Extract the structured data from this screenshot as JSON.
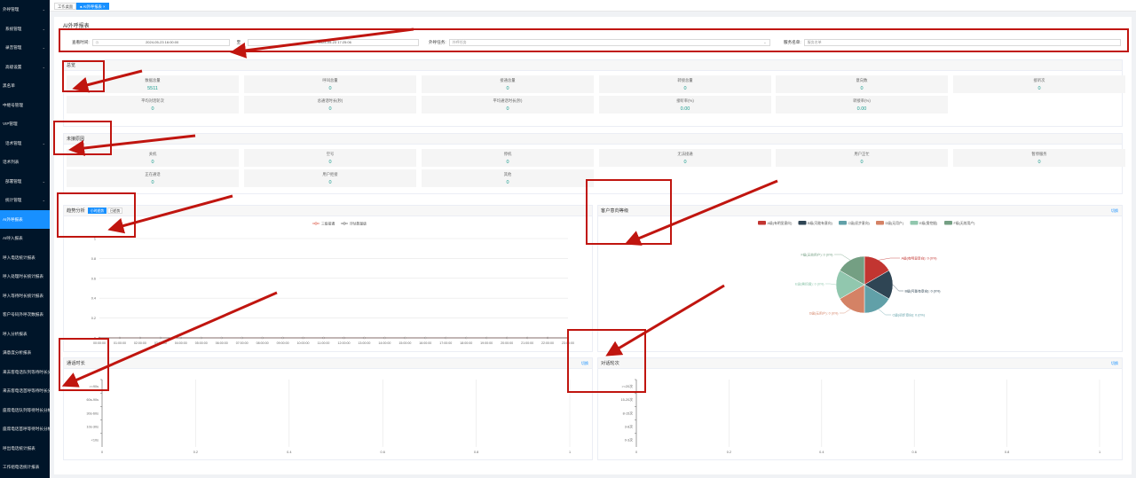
{
  "sidebar": {
    "items": [
      {
        "label": "外呼管理",
        "arrow": "⌄",
        "active": false,
        "sub": false
      },
      {
        "label": "系统管理",
        "arrow": "⌄",
        "active": false,
        "sub": true
      },
      {
        "label": "录音管理",
        "arrow": "⌄",
        "active": false,
        "sub": true
      },
      {
        "label": "高级设置",
        "arrow": "⌄",
        "active": false,
        "sub": true
      },
      {
        "label": "黑名单",
        "arrow": "",
        "active": false,
        "sub": false
      },
      {
        "label": "中继号管理",
        "arrow": "",
        "active": false,
        "sub": false
      },
      {
        "label": "VIP管理",
        "arrow": "",
        "active": false,
        "sub": false
      },
      {
        "label": "话术管理",
        "arrow": "⌄",
        "active": false,
        "sub": true
      },
      {
        "label": "话术列表",
        "arrow": "",
        "active": false,
        "sub": false
      },
      {
        "label": "部署管理",
        "arrow": "⌄",
        "active": false,
        "sub": true
      },
      {
        "label": "统计管理",
        "arrow": "⌄",
        "active": false,
        "sub": true
      },
      {
        "label": "AI外呼报表",
        "arrow": "",
        "active": true,
        "sub": false
      },
      {
        "label": "AI呼入报表",
        "arrow": "",
        "active": false,
        "sub": false
      },
      {
        "label": "呼入电话统计报表",
        "arrow": "",
        "active": false,
        "sub": false
      },
      {
        "label": "呼入处理时长统计报表",
        "arrow": "",
        "active": false,
        "sub": false
      },
      {
        "label": "呼入等待时长统计报表",
        "arrow": "",
        "active": false,
        "sub": false
      },
      {
        "label": "客户号码外呼次数报表",
        "arrow": "",
        "active": false,
        "sub": false
      },
      {
        "label": "呼入分析报表",
        "arrow": "",
        "active": false,
        "sub": false
      },
      {
        "label": "满意度分析报表",
        "arrow": "",
        "active": false,
        "sub": false
      },
      {
        "label": "来去客电话队列等待时长分析",
        "arrow": "",
        "active": false,
        "sub": false
      },
      {
        "label": "来去客电话首呼等待时长分析",
        "arrow": "",
        "active": false,
        "sub": false
      },
      {
        "label": "座席电话队列等待时长分析",
        "arrow": "",
        "active": false,
        "sub": false
      },
      {
        "label": "座席电话首呼等待时长分析",
        "arrow": "",
        "active": false,
        "sub": false
      },
      {
        "label": "呼出电话统计报表",
        "arrow": "",
        "active": false,
        "sub": false
      },
      {
        "label": "工作组电话统计报表",
        "arrow": "",
        "active": false,
        "sub": false
      }
    ]
  },
  "tabs": [
    {
      "label": "工作桌面",
      "active": false
    },
    {
      "label": "● AI外呼报表 ×",
      "active": true
    }
  ],
  "page_title": "AI外呼报表",
  "filters": {
    "time_label": "查看时间:",
    "time_start": "2024-05-23 16:00:00",
    "time_sep": "至",
    "time_end": "2024-05-23 17:25:06",
    "clock_icon": "◷",
    "task_label": "外呼任务:",
    "task_placeholder": "外呼任务",
    "task_chevron": "⌄",
    "group_label": "服务名单:",
    "group_placeholder": "服务名单"
  },
  "overview": {
    "title": "总览",
    "row1": [
      {
        "label": "数据总量",
        "value": "5511"
      },
      {
        "label": "呼叫总量",
        "value": "0"
      },
      {
        "label": "接通总量",
        "value": "0"
      },
      {
        "label": "转接总量",
        "value": "0"
      },
      {
        "label": "意向数",
        "value": "0"
      },
      {
        "label": "接听次",
        "value": "0"
      }
    ],
    "row2": [
      {
        "label": "平均对话轮次",
        "value": "0"
      },
      {
        "label": "总通话时长(秒)",
        "value": "0"
      },
      {
        "label": "平均通话时长(秒)",
        "value": "0"
      },
      {
        "label": "接听率(%)",
        "value": "0.00"
      },
      {
        "label": "转接率(%)",
        "value": "0.00"
      }
    ]
  },
  "unanswered": {
    "title": "未接原因",
    "row1": [
      {
        "label": "关机",
        "value": "0"
      },
      {
        "label": "空号",
        "value": "0"
      },
      {
        "label": "停机",
        "value": "0"
      },
      {
        "label": "无法接通",
        "value": "0"
      },
      {
        "label": "用户正忙",
        "value": "0"
      },
      {
        "label": "暂停服务",
        "value": "0"
      }
    ],
    "row2": [
      {
        "label": "正在通话",
        "value": "0"
      },
      {
        "label": "用户拒接",
        "value": "0"
      },
      {
        "label": "其他",
        "value": "0"
      }
    ]
  },
  "trend": {
    "title": "趋势分析",
    "btn_hour": "小时趋势",
    "btn_day": "日趋势",
    "chart_data": {
      "type": "line",
      "series": [
        {
          "name": "三级接通",
          "color": "#e06a5a",
          "values": [
            0,
            0,
            0,
            0,
            0,
            0,
            0,
            0,
            0,
            0,
            0,
            0,
            0,
            0,
            0,
            0,
            0,
            0,
            0,
            0,
            0,
            0,
            0,
            0
          ]
        },
        {
          "name": "评估数量级",
          "color": "#6b6b6b",
          "values": [
            0,
            0,
            0,
            0,
            0,
            0,
            0,
            0,
            0,
            0,
            0,
            0,
            0,
            0,
            0,
            0,
            0,
            0,
            0,
            0,
            0,
            0,
            0,
            0
          ]
        }
      ],
      "categories": [
        "00:00:00",
        "01:00:00",
        "02:00:00",
        "03:00:00",
        "04:00:00",
        "05:00:00",
        "06:00:00",
        "07:00:00",
        "08:00:00",
        "09:00:00",
        "10:00:00",
        "11:00:00",
        "12:00:00",
        "13:00:00",
        "14:00:00",
        "15:00:00",
        "16:00:00",
        "17:00:00",
        "18:00:00",
        "19:00:00",
        "20:00:00",
        "21:00:00",
        "22:00:00",
        "23:00:00"
      ],
      "y_ticks": [
        "0",
        "0.2",
        "0.4",
        "0.6",
        "0.8",
        "1"
      ],
      "ylim": [
        0,
        1
      ],
      "grid": true,
      "legend": "top-center"
    }
  },
  "grade": {
    "title": "客户意向等级",
    "switch_label": "切换",
    "chart_data": {
      "type": "pie",
      "legend": [
        {
          "name": "A级(有明显意向)",
          "color": "#c23531"
        },
        {
          "name": "B级(可能有意向)",
          "color": "#2f4554"
        },
        {
          "name": "C级(初步意向)",
          "color": "#61a0a8"
        },
        {
          "name": "D级(无用户)",
          "color": "#d48265"
        },
        {
          "name": "E级(需挖掘)",
          "color": "#91c7ae"
        },
        {
          "name": "F级(无效用户)",
          "color": "#749f83"
        }
      ],
      "slices": [
        {
          "label": "A级(有明显意向): 0 (0%)",
          "value": 1,
          "color": "#c23531"
        },
        {
          "label": "B级(可能有意向): 0 (0%)",
          "value": 1,
          "color": "#2f4554"
        },
        {
          "label": "C级(初步意向): 0 (0%)",
          "value": 1,
          "color": "#61a0a8"
        },
        {
          "label": "D级(无用户): 0 (0%)",
          "value": 1,
          "color": "#d48265"
        },
        {
          "label": "E级(需挖掘): 0 (0%)",
          "value": 1,
          "color": "#91c7ae"
        },
        {
          "label": "F级(无效用户): 0 (0%)",
          "value": 1,
          "color": "#749f83"
        }
      ]
    }
  },
  "duration": {
    "title": "通话时长",
    "switch_label": "切换",
    "chart_data": {
      "type": "bar",
      "categories": [
        ">=90s",
        "60s-90s",
        "30s-60s",
        "10s-30s",
        "<10s"
      ],
      "values": [
        0,
        0,
        0,
        0,
        0
      ],
      "x_ticks": [
        "0",
        "0.2",
        "0.4",
        "0.6",
        "0.8",
        "1"
      ],
      "xlim": [
        0,
        1
      ]
    }
  },
  "rounds": {
    "title": "对话轮次",
    "switch_label": "切换",
    "chart_data": {
      "type": "bar",
      "categories": [
        ">=20次",
        "15-20次",
        "8-15次",
        "3-8次",
        "0-3次"
      ],
      "values": [
        0,
        0,
        0,
        0,
        0
      ],
      "x_ticks": [
        "0",
        "0.2",
        "0.4",
        "0.6",
        "0.8",
        "1"
      ],
      "xlim": [
        0,
        1
      ]
    }
  }
}
